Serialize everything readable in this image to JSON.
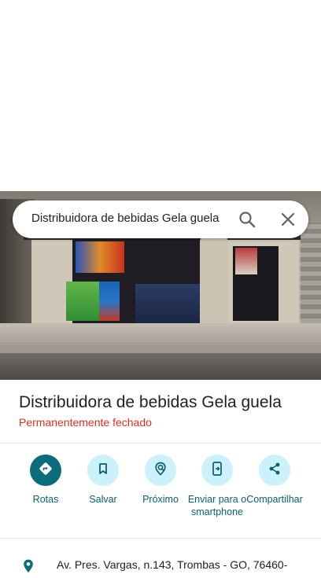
{
  "search": {
    "query": "Distribuidora de bebidas Gela guela"
  },
  "place": {
    "title": "Distribuidora de bebidas Gela guela",
    "status": "Permanentemente fechado"
  },
  "actions": {
    "rotas": "Rotas",
    "salvar": "Salvar",
    "proximo": "Próximo",
    "enviar": "Enviar para o smartphone",
    "compartilhar": "Compartilhar"
  },
  "address": {
    "text": "Av. Pres. Vargas, n.143, Trombas - GO, 76460-"
  },
  "icons": {
    "search": "search-icon",
    "close": "close-icon",
    "directions": "directions-icon",
    "save": "bookmark-icon",
    "nearby": "nearby-icon",
    "send": "send-to-phone-icon",
    "share": "share-icon",
    "pin": "location-pin-icon"
  },
  "colors": {
    "accent": "#0b6c7b",
    "accent_light": "#cdf1fa",
    "status_closed": "#d93025",
    "label_text": "#0b5f6d"
  }
}
